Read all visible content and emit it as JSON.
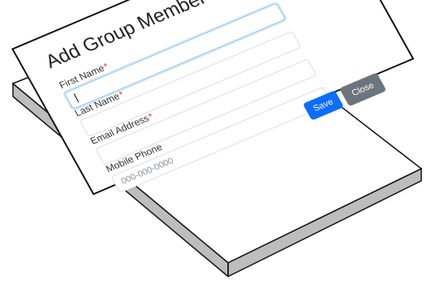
{
  "dialog": {
    "title": "Add Group Member",
    "close_icon": "close-icon"
  },
  "form": {
    "first_name_label": "First Name",
    "first_name_required": "*",
    "last_name_label": "Last Name",
    "last_name_required": "*",
    "email_label": "Email Address",
    "email_required": "*",
    "mobile_label": "Mobile Phone",
    "mobile_placeholder": "000-000-0000"
  },
  "actions": {
    "save_label": "Save",
    "close_label": "Close"
  },
  "colors": {
    "primary": "#0d6efd",
    "secondary": "#6c757d",
    "required": "#dc3545",
    "focus_border": "#8ec3f2"
  }
}
